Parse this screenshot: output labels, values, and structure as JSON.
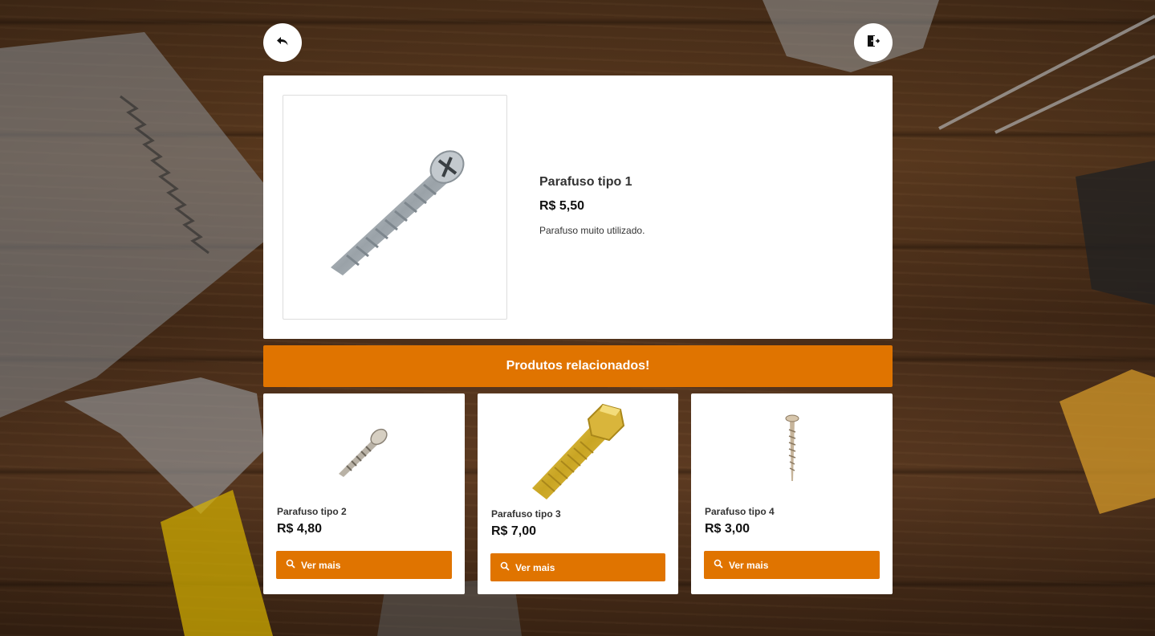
{
  "header": {
    "back_icon": "reply-arrow-icon",
    "logout_icon": "door-exit-icon"
  },
  "product": {
    "name": "Parafuso tipo 1",
    "price": "R$ 5,50",
    "description": "Parafuso muito utilizado.",
    "image_icon": "silver-screw-image"
  },
  "related": {
    "heading": "Produtos relacionados!",
    "items": [
      {
        "name": "Parafuso tipo 2",
        "price": "R$ 4,80",
        "button": "Ver mais"
      },
      {
        "name": "Parafuso tipo 3",
        "price": "R$ 7,00",
        "button": "Ver mais"
      },
      {
        "name": "Parafuso tipo 4",
        "price": "R$ 3,00",
        "button": "Ver mais"
      }
    ]
  },
  "colors": {
    "accent": "#e07400",
    "card": "#ffffff"
  }
}
